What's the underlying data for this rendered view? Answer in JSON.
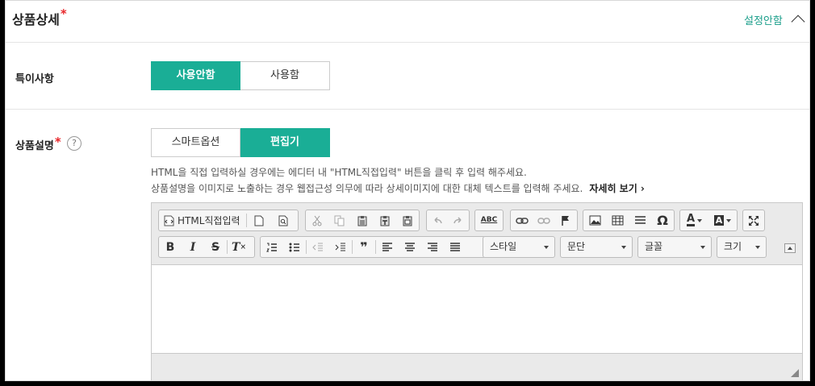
{
  "section": {
    "title": "상품상세",
    "required_mark": "*",
    "collapse_label": "설정안함"
  },
  "special_notes": {
    "label": "특이사항",
    "options": [
      "사용안함",
      "사용함"
    ],
    "selected": "사용안함"
  },
  "description": {
    "label": "상품설명",
    "required_mark": "*",
    "help_glyph": "?",
    "modes": [
      "스마트옵션",
      "편집기"
    ],
    "selected_mode": "편집기",
    "note_line1": "HTML을 직접 입력하실 경우에는 에디터 내 \"HTML직접입력\" 버튼을 클릭 후 입력 해주세요.",
    "note_line2": "상품설명을 이미지로 노출하는 경우 웹접근성 의무에 따라 상세이미지에 대한 대체 텍스트를 입력해 주세요.",
    "more_link": "자세히 보기 ›"
  },
  "editor": {
    "html_button_label": "HTML직접입력",
    "combos": {
      "style": "스타일",
      "paragraph": "문단",
      "font": "글꼴",
      "size": "크기"
    },
    "icons": {
      "row1": [
        "html-source-icon",
        "new-page-icon",
        "preview-icon",
        "cut-icon",
        "copy-icon",
        "paste-icon",
        "paste-text-icon",
        "paste-word-icon",
        "undo-icon",
        "redo-icon",
        "spellcheck-icon",
        "link-icon",
        "unlink-icon",
        "anchor-flag-icon",
        "image-icon",
        "table-icon",
        "horizontal-line-icon",
        "special-char-icon",
        "text-color-icon",
        "background-color-icon",
        "maximize-icon"
      ],
      "row2": [
        "bold-icon",
        "italic-icon",
        "strikethrough-icon",
        "remove-format-icon",
        "numbered-list-icon",
        "bulleted-list-icon",
        "decrease-indent-icon",
        "increase-indent-icon",
        "blockquote-icon",
        "align-left-icon",
        "align-center-icon",
        "align-right-icon",
        "justify-icon"
      ]
    },
    "glyphs": {
      "bold": "B",
      "italic": "I",
      "strike": "S",
      "clear": "T",
      "quote": "❞",
      "omega": "Ω",
      "color_a": "A",
      "spell": "ABC"
    }
  },
  "colors": {
    "accent": "#1aae96",
    "link": "#1a9e8a",
    "required": "#e8262a"
  }
}
